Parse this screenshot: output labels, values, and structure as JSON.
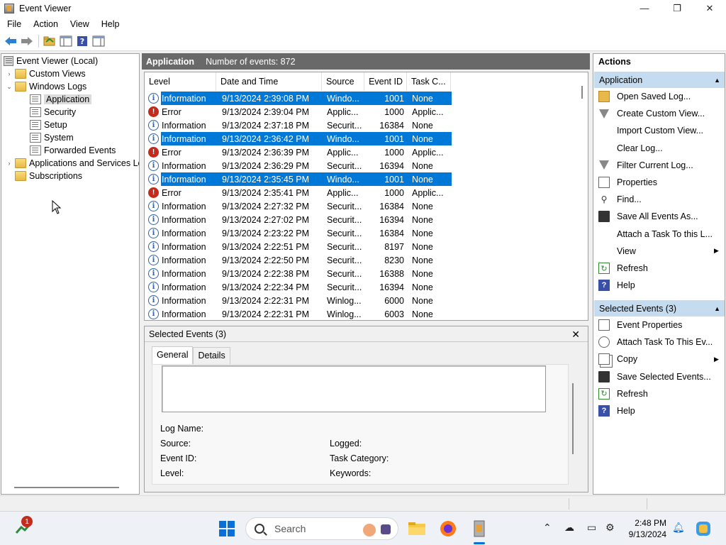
{
  "window": {
    "title": "Event Viewer",
    "minimize": "—",
    "restore": "❐",
    "close": "✕"
  },
  "menu": [
    "File",
    "Action",
    "View",
    "Help"
  ],
  "toolbar": {
    "icons": [
      "back-arrow-icon",
      "forward-arrow-icon",
      "open-folder-icon",
      "show-hide-tree-icon",
      "help-icon",
      "show-hide-action-pane-icon"
    ]
  },
  "tree": {
    "items": [
      {
        "label": "Event Viewer (Local)",
        "level": 0,
        "expander": "",
        "icon": "event-viewer-icon"
      },
      {
        "label": "Custom Views",
        "level": 1,
        "expander": "›",
        "icon": "folder-icon"
      },
      {
        "label": "Windows Logs",
        "level": 1,
        "expander": "⌄",
        "icon": "folder-icon"
      },
      {
        "label": "Application",
        "level": 2,
        "expander": "",
        "icon": "log-icon",
        "selected": true
      },
      {
        "label": "Security",
        "level": 2,
        "expander": "",
        "icon": "log-icon"
      },
      {
        "label": "Setup",
        "level": 2,
        "expander": "",
        "icon": "log-icon"
      },
      {
        "label": "System",
        "level": 2,
        "expander": "",
        "icon": "log-icon"
      },
      {
        "label": "Forwarded Events",
        "level": 2,
        "expander": "",
        "icon": "log-icon"
      },
      {
        "label": "Applications and Services Lo",
        "level": 1,
        "expander": "›",
        "icon": "folder-icon"
      },
      {
        "label": "Subscriptions",
        "level": 1,
        "expander": "",
        "icon": "folder-icon"
      }
    ]
  },
  "log_header": {
    "name": "Application",
    "count": "Number of events: 872"
  },
  "columns": [
    "Level",
    "Date and Time",
    "Source",
    "Event ID",
    "Task C..."
  ],
  "events": [
    {
      "level": "Information",
      "date": "9/13/2024 2:39:08 PM",
      "source": "Windo...",
      "id": "1001",
      "task": "None",
      "selected": true
    },
    {
      "level": "Error",
      "date": "9/13/2024 2:39:04 PM",
      "source": "Applic...",
      "id": "1000",
      "task": "Applic...",
      "selected": false
    },
    {
      "level": "Information",
      "date": "9/13/2024 2:37:18 PM",
      "source": "Securit...",
      "id": "16384",
      "task": "None",
      "selected": false
    },
    {
      "level": "Information",
      "date": "9/13/2024 2:36:42 PM",
      "source": "Windo...",
      "id": "1001",
      "task": "None",
      "selected": true
    },
    {
      "level": "Error",
      "date": "9/13/2024 2:36:39 PM",
      "source": "Applic...",
      "id": "1000",
      "task": "Applic...",
      "selected": false
    },
    {
      "level": "Information",
      "date": "9/13/2024 2:36:29 PM",
      "source": "Securit...",
      "id": "16394",
      "task": "None",
      "selected": false
    },
    {
      "level": "Information",
      "date": "9/13/2024 2:35:45 PM",
      "source": "Windo...",
      "id": "1001",
      "task": "None",
      "selected": true
    },
    {
      "level": "Error",
      "date": "9/13/2024 2:35:41 PM",
      "source": "Applic...",
      "id": "1000",
      "task": "Applic...",
      "selected": false
    },
    {
      "level": "Information",
      "date": "9/13/2024 2:27:32 PM",
      "source": "Securit...",
      "id": "16384",
      "task": "None",
      "selected": false
    },
    {
      "level": "Information",
      "date": "9/13/2024 2:27:02 PM",
      "source": "Securit...",
      "id": "16394",
      "task": "None",
      "selected": false
    },
    {
      "level": "Information",
      "date": "9/13/2024 2:23:22 PM",
      "source": "Securit...",
      "id": "16384",
      "task": "None",
      "selected": false
    },
    {
      "level": "Information",
      "date": "9/13/2024 2:22:51 PM",
      "source": "Securit...",
      "id": "8197",
      "task": "None",
      "selected": false
    },
    {
      "level": "Information",
      "date": "9/13/2024 2:22:50 PM",
      "source": "Securit...",
      "id": "8230",
      "task": "None",
      "selected": false
    },
    {
      "level": "Information",
      "date": "9/13/2024 2:22:38 PM",
      "source": "Securit...",
      "id": "16388",
      "task": "None",
      "selected": false
    },
    {
      "level": "Information",
      "date": "9/13/2024 2:22:34 PM",
      "source": "Securit...",
      "id": "16394",
      "task": "None",
      "selected": false
    },
    {
      "level": "Information",
      "date": "9/13/2024 2:22:31 PM",
      "source": "Winlog...",
      "id": "6000",
      "task": "None",
      "selected": false
    },
    {
      "level": "Information",
      "date": "9/13/2024 2:22:31 PM",
      "source": "Winlog...",
      "id": "6003",
      "task": "None",
      "selected": false
    }
  ],
  "detail": {
    "title": "Selected Events (3)",
    "close": "✕",
    "tabs": [
      "General",
      "Details"
    ],
    "fields": {
      "log_name": "Log Name:",
      "source": "Source:",
      "event_id": "Event ID:",
      "level": "Level:",
      "logged": "Logged:",
      "task_category": "Task Category:",
      "keywords": "Keywords:"
    }
  },
  "actions": {
    "header": "Actions",
    "section1": {
      "title": "Application",
      "items": [
        {
          "label": "Open Saved Log...",
          "icon": "open-folder-icon"
        },
        {
          "label": "Create Custom View...",
          "icon": "filter-icon"
        },
        {
          "label": "Import Custom View...",
          "icon": ""
        },
        {
          "label": "Clear Log...",
          "icon": ""
        },
        {
          "label": "Filter Current Log...",
          "icon": "filter-icon"
        },
        {
          "label": "Properties",
          "icon": "properties-icon"
        },
        {
          "label": "Find...",
          "icon": "binoculars-icon"
        },
        {
          "label": "Save All Events As...",
          "icon": "save-icon"
        },
        {
          "label": "Attach a Task To this L...",
          "icon": ""
        },
        {
          "label": "View",
          "icon": "",
          "submenu": true
        },
        {
          "label": "Refresh",
          "icon": "refresh-icon"
        },
        {
          "label": "Help",
          "icon": "help-icon"
        }
      ]
    },
    "section2": {
      "title": "Selected Events (3)",
      "items": [
        {
          "label": "Event Properties",
          "icon": "properties-icon"
        },
        {
          "label": "Attach Task To This Ev...",
          "icon": "task-clock-icon"
        },
        {
          "label": "Copy",
          "icon": "copy-icon",
          "submenu": true
        },
        {
          "label": "Save Selected Events...",
          "icon": "save-icon"
        },
        {
          "label": "Refresh",
          "icon": "refresh-icon"
        },
        {
          "label": "Help",
          "icon": "help-icon"
        }
      ]
    }
  },
  "taskbar": {
    "search_placeholder": "Search",
    "badge": "1",
    "time": "2:48 PM",
    "date": "9/13/2024"
  }
}
